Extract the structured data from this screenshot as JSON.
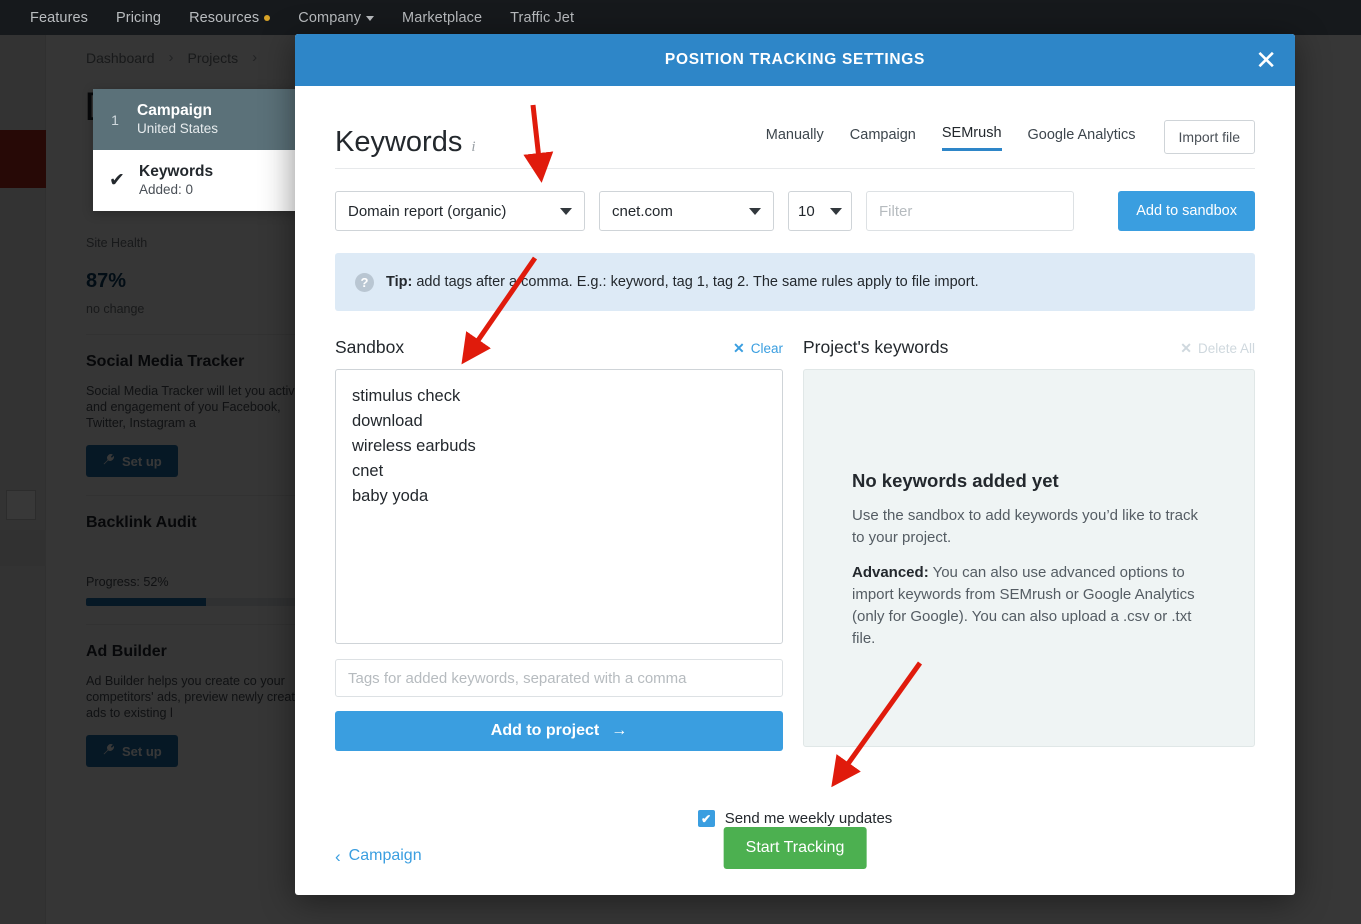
{
  "topnav": {
    "items": [
      {
        "label": "Features",
        "badge": false,
        "caret": false
      },
      {
        "label": "Pricing",
        "badge": false,
        "caret": false
      },
      {
        "label": "Resources",
        "badge": true,
        "caret": false
      },
      {
        "label": "Company",
        "badge": false,
        "caret": true
      },
      {
        "label": "Marketplace",
        "badge": false,
        "caret": false
      },
      {
        "label": "Traffic Jet",
        "badge": false,
        "caret": false
      }
    ]
  },
  "background": {
    "breadcrumb": [
      "Dashboard",
      "Projects"
    ],
    "breadcrumb_separator": "›",
    "page_title": "[",
    "steps": [
      {
        "num": "1",
        "title": "Campaign",
        "sub": "United States",
        "state": "active"
      },
      {
        "check": "✔",
        "title": "Keywords",
        "sub": "Added: 0",
        "state": "done"
      }
    ],
    "cards": [
      {
        "name": "site-health",
        "label": "Site Health",
        "value": "87",
        "unit": "%",
        "change": "no change"
      },
      {
        "name": "social-media-tracker",
        "title": "Social Media Tracker",
        "body": "Social Media Tracker will let you activity and engagement of you Facebook, Twitter, Instagram a",
        "button": "Set up",
        "icon": "wrench-icon"
      },
      {
        "name": "backlink-audit",
        "title": "Backlink Audit",
        "progress_label": "Progress: 52%",
        "progress_pct": 52
      },
      {
        "name": "ad-builder",
        "title": "Ad Builder",
        "body": "Ad Builder helps you create co your competitors' ads, preview newly created ads to existing l",
        "button": "Set up",
        "icon": "wrench-icon"
      }
    ]
  },
  "modal": {
    "title": "POSITION TRACKING SETTINGS",
    "close_icon": "✕",
    "heading": "Keywords",
    "heading_info_icon": "i",
    "tabs": [
      {
        "label": "Manually",
        "active": false
      },
      {
        "label": "Campaign",
        "active": false
      },
      {
        "label": "SEMrush",
        "active": true
      },
      {
        "label": "Google Analytics",
        "active": false
      }
    ],
    "import_button": "Import file",
    "controls": {
      "report_select": "Domain report (organic)",
      "domain_select": "cnet.com",
      "limit_select": "10",
      "filter_placeholder": "Filter",
      "add_sandbox_button": "Add to sandbox"
    },
    "tip": {
      "icon": "?",
      "label": "Tip:",
      "text": " add tags after a comma. E.g.: keyword, tag 1, tag 2. The same rules apply to file import."
    },
    "sandbox": {
      "title": "Sandbox",
      "clear_link": "Clear",
      "clear_icon": "✕",
      "keywords": [
        "stimulus check",
        "download",
        "wireless earbuds",
        "cnet",
        "baby yoda"
      ],
      "tags_placeholder": "Tags for added keywords, separated with a comma",
      "add_button": "Add to project",
      "add_button_arrow": "→"
    },
    "project_keywords": {
      "title": "Project's keywords",
      "delete_all_link": "Delete All",
      "delete_all_icon": "✕",
      "empty_title": "No keywords added yet",
      "empty_body_1": "Use the sandbox to add keywords you’d like to track to your project.",
      "empty_advanced_label": "Advanced:",
      "empty_body_2": " You can also use advanced options to import keywords from SEMrush or Google Analytics (only for Google). You can also upload a .csv or .txt file."
    },
    "footer": {
      "weekly_checkbox_label": "Send me weekly updates",
      "weekly_checked": true,
      "check_glyph": "✔",
      "back_link": "Campaign",
      "back_icon": "‹",
      "start_button": "Start Tracking"
    }
  },
  "colors": {
    "modal_header": "#2e86c8",
    "primary_blue": "#3a9ee0",
    "start_green": "#4cb050",
    "tip_bg": "#ddeaf6",
    "annotation_red": "#e01b0c"
  }
}
